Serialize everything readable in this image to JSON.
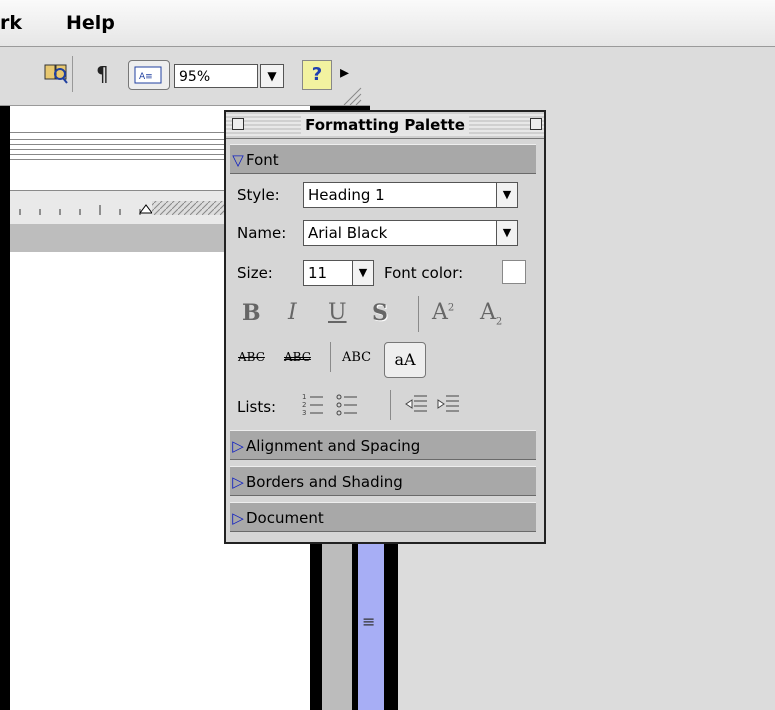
{
  "menubar": {
    "items": [
      "rk",
      "Help"
    ]
  },
  "toolbar": {
    "zoom_value": "95%",
    "icons": [
      "book-icon",
      "paragraph-icon",
      "view-icon",
      "help-icon",
      "more-arrow-icon"
    ],
    "paragraph_glyph": "¶",
    "help_glyph": "?",
    "more_glyph": "▸",
    "dropdown_glyph": "▼"
  },
  "palette": {
    "title": "Formatting Palette",
    "font_section": {
      "label": "Font",
      "style_label": "Style:",
      "style_value": "Heading 1",
      "name_label": "Name:",
      "name_value": "Arial Black",
      "size_label": "Size:",
      "size_value": "11",
      "font_color_label": "Font color:",
      "format_buttons": [
        "B",
        "I",
        "U",
        "S",
        "A",
        "A"
      ],
      "effect_buttons": [
        "ABC",
        "ABC",
        "ABC",
        "aA"
      ],
      "lists_label": "Lists:"
    },
    "sections": [
      {
        "label": "Alignment and Spacing"
      },
      {
        "label": "Borders and Shading"
      },
      {
        "label": "Document"
      }
    ]
  },
  "scrollbar": {
    "thumb_glyph": "≡"
  }
}
